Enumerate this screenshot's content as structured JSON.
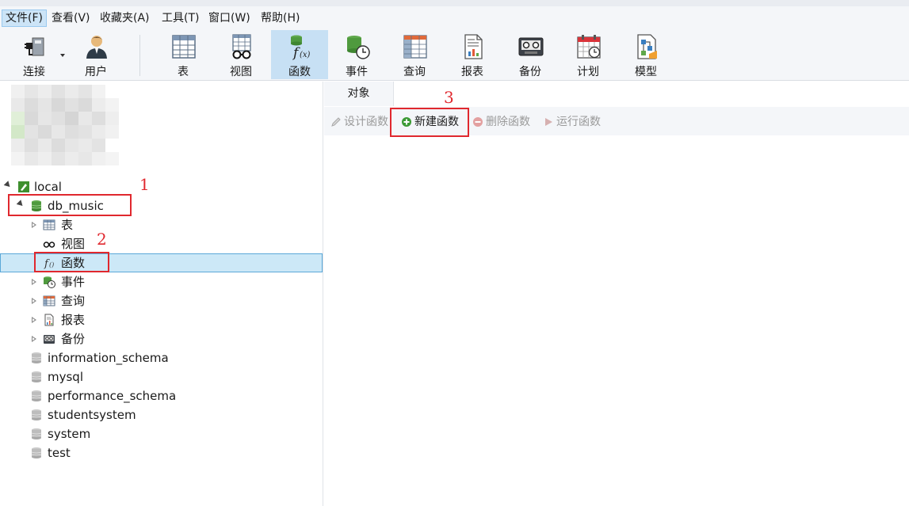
{
  "menu": {
    "file": "文件(F)",
    "view": "查看(V)",
    "favorites": "收藏夹(A)",
    "tools": "工具(T)",
    "window": "窗口(W)",
    "help": "帮助(H)"
  },
  "toolbar": {
    "connect": "连接",
    "user": "用户",
    "table": "表",
    "view": "视图",
    "function": "函数",
    "event": "事件",
    "query": "查询",
    "report": "报表",
    "backup": "备份",
    "schedule": "计划",
    "model": "模型"
  },
  "tree": {
    "connection": "local",
    "database": "db_music",
    "children": {
      "tables": "表",
      "views": "视图",
      "functions": "函数",
      "events": "事件",
      "queries": "查询",
      "reports": "报表",
      "backups": "备份"
    },
    "other_databases": [
      "information_schema",
      "mysql",
      "performance_schema",
      "studentsystem",
      "system",
      "test"
    ]
  },
  "tabs": {
    "objects": "对象"
  },
  "object_toolbar": {
    "design": "设计函数",
    "new": "新建函数",
    "delete": "删除函数",
    "run": "运行函数"
  },
  "annotations": {
    "n1": "1",
    "n2": "2",
    "n3": "3"
  },
  "colors": {
    "annotation": "#e0282e",
    "selection": "#cce8f7",
    "active_toolbar": "#c7e0f4"
  },
  "icons": [
    "plug-icon",
    "user-icon",
    "table-icon",
    "view-glasses-icon",
    "function-icon",
    "event-icon",
    "query-icon",
    "report-icon",
    "backup-icon",
    "schedule-icon",
    "model-icon",
    "database-icon",
    "connection-icon"
  ]
}
